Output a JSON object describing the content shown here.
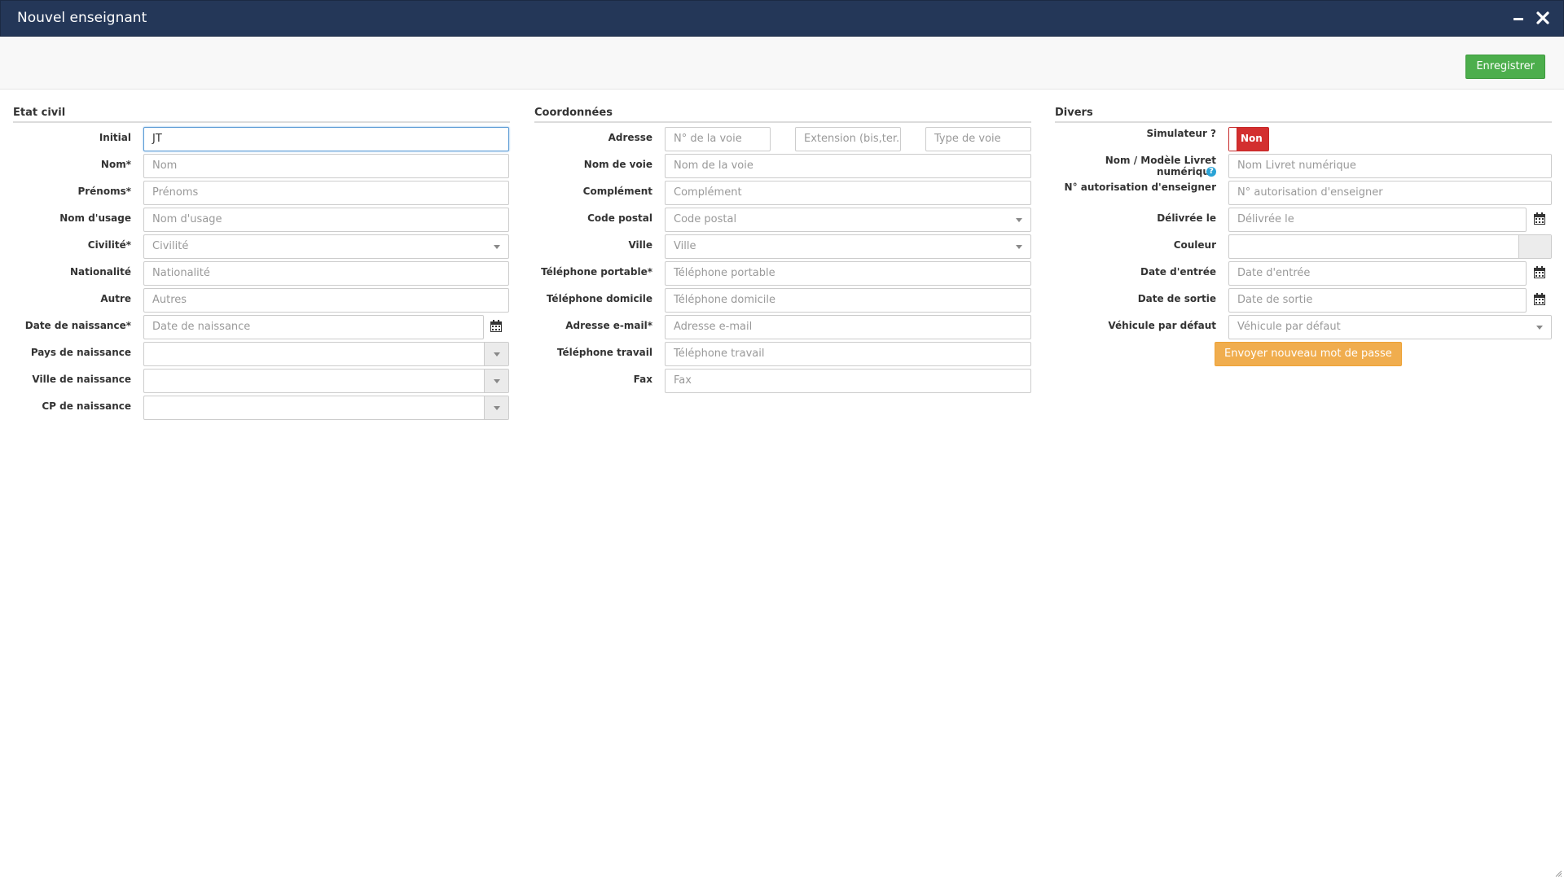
{
  "window": {
    "title": "Nouvel enseignant"
  },
  "toolbar": {
    "save_label": "Enregistrer"
  },
  "etat_civil": {
    "title": "Etat civil",
    "initial": {
      "label": "Initial",
      "value": "JT"
    },
    "nom": {
      "label": "Nom*",
      "placeholder": "Nom"
    },
    "prenoms": {
      "label": "Prénoms*",
      "placeholder": "Prénoms"
    },
    "nom_usage": {
      "label": "Nom d'usage",
      "placeholder": "Nom d'usage"
    },
    "civilite": {
      "label": "Civilité*",
      "placeholder": "Civilité"
    },
    "nationalite": {
      "label": "Nationalité",
      "placeholder": "Nationalité"
    },
    "autre": {
      "label": "Autre",
      "placeholder": "Autres"
    },
    "date_naissance": {
      "label": "Date de naissance*",
      "placeholder": "Date de naissance"
    },
    "pays_naissance": {
      "label": "Pays de naissance",
      "value": ""
    },
    "ville_naissance": {
      "label": "Ville de naissance",
      "value": ""
    },
    "cp_naissance": {
      "label": "CP de naissance",
      "value": ""
    }
  },
  "coordonnees": {
    "title": "Coordonnées",
    "adresse": {
      "label": "Adresse",
      "num_placeholder": "N° de la voie",
      "ext_placeholder": "Extension (bis,ter...",
      "type_placeholder": "Type de voie"
    },
    "nom_voie": {
      "label": "Nom de voie",
      "placeholder": "Nom de la voie"
    },
    "complement": {
      "label": "Complément",
      "placeholder": "Complément"
    },
    "code_postal": {
      "label": "Code postal",
      "placeholder": "Code postal"
    },
    "ville": {
      "label": "Ville",
      "placeholder": "Ville"
    },
    "tel_portable": {
      "label": "Téléphone portable*",
      "placeholder": "Téléphone portable"
    },
    "tel_domicile": {
      "label": "Téléphone domicile",
      "placeholder": "Téléphone domicile"
    },
    "email": {
      "label": "Adresse e-mail*",
      "placeholder": "Adresse e-mail"
    },
    "tel_travail": {
      "label": "Téléphone travail",
      "placeholder": "Téléphone travail"
    },
    "fax": {
      "label": "Fax",
      "placeholder": "Fax"
    }
  },
  "divers": {
    "title": "Divers",
    "simulateur": {
      "label": "Simulateur ?",
      "state": "Non"
    },
    "livret": {
      "label": "Nom / Modèle Livret numérique",
      "placeholder": "Nom Livret numérique"
    },
    "autorisation": {
      "label": "N° autorisation d'enseigner",
      "placeholder": "N° autorisation d'enseigner"
    },
    "delivree": {
      "label": "Délivrée le",
      "placeholder": "Délivrée le"
    },
    "couleur": {
      "label": "Couleur",
      "value": ""
    },
    "date_entree": {
      "label": "Date d'entrée",
      "placeholder": "Date d'entrée"
    },
    "date_sortie": {
      "label": "Date de sortie",
      "placeholder": "Date de sortie"
    },
    "vehicule": {
      "label": "Véhicule par défaut",
      "placeholder": "Véhicule par défaut"
    },
    "reset_password_label": "Envoyer nouveau mot de passe"
  },
  "colors": {
    "titlebar": "#243758",
    "save": "#4cae4c",
    "toggle_off": "#d32f2f",
    "orange": "#f0ad4e",
    "help": "#2aa3d6"
  },
  "icons": [
    "minimize-icon",
    "close-icon",
    "calendar-icon",
    "help-icon",
    "caret-down-icon",
    "resize-grip-icon"
  ]
}
